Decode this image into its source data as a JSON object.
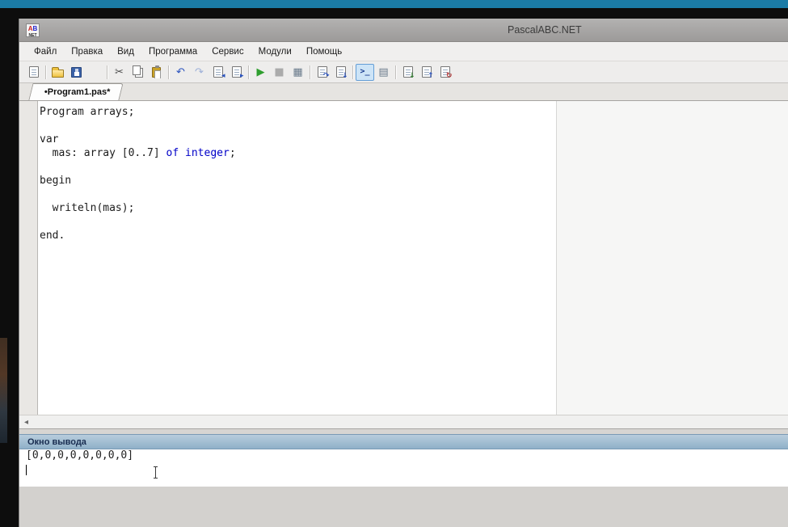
{
  "window": {
    "title": "PascalABC.NET",
    "logo_a": "A",
    "logo_b": "B",
    "logo_net": "NET"
  },
  "menu": {
    "items": [
      "Файл",
      "Правка",
      "Вид",
      "Программа",
      "Сервис",
      "Модули",
      "Помощь"
    ]
  },
  "toolbar": {
    "items": [
      {
        "name": "new-file",
        "kind": "page"
      },
      {
        "sep": true
      },
      {
        "name": "open-file",
        "kind": "folder"
      },
      {
        "name": "save-file",
        "kind": "floppy"
      },
      {
        "name": "save-all",
        "kind": "floppy2"
      },
      {
        "sep": true
      },
      {
        "name": "cut",
        "kind": "glyph",
        "glyph": "✂",
        "color": "#4a4a4a"
      },
      {
        "name": "copy",
        "kind": "copy"
      },
      {
        "name": "paste",
        "kind": "paste"
      },
      {
        "sep": true
      },
      {
        "name": "undo",
        "kind": "glyph",
        "glyph": "↶",
        "color": "#2a52be"
      },
      {
        "name": "redo",
        "kind": "glyph",
        "glyph": "↷",
        "color": "#9db0d8"
      },
      {
        "name": "prev-location",
        "kind": "page",
        "badge": "◂",
        "badgeColor": "#2a52be"
      },
      {
        "name": "next-location",
        "kind": "page",
        "badge": "▸",
        "badgeColor": "#2a52be"
      },
      {
        "sep": true
      },
      {
        "name": "run",
        "kind": "glyph",
        "glyph": "▶",
        "color": "#2f9e2f"
      },
      {
        "name": "stop",
        "kind": "glyph",
        "glyph": "■",
        "color": "#ababab"
      },
      {
        "name": "compile",
        "kind": "glyph",
        "glyph": "▦",
        "color": "#68798a"
      },
      {
        "sep": true
      },
      {
        "name": "step-over",
        "kind": "page",
        "badge": "↷",
        "badgeColor": "#2a52be"
      },
      {
        "name": "step-into",
        "kind": "page",
        "badge": "↓",
        "badgeColor": "#2a52be"
      },
      {
        "sep": true
      },
      {
        "name": "output-window-toggle",
        "kind": "glyph",
        "glyph": ">_",
        "color": "#1a3c8f",
        "pressed": true,
        "mono": true
      },
      {
        "name": "show-form",
        "kind": "glyph",
        "glyph": "▤",
        "color": "#68798a"
      },
      {
        "sep": true
      },
      {
        "name": "add-unit",
        "kind": "page",
        "badge": "↓",
        "badgeColor": "#2f7f2f"
      },
      {
        "name": "goto-unit",
        "kind": "page",
        "badge": "↑",
        "badgeColor": "#2a52be"
      },
      {
        "name": "reload-unit",
        "kind": "page",
        "badge": "↻",
        "badgeColor": "#b03030"
      }
    ]
  },
  "tab": {
    "label": "•Program1.pas*"
  },
  "editor": {
    "lines": [
      [
        {
          "t": "Program arrays;",
          "c": "plain"
        }
      ],
      [],
      [
        {
          "t": "var",
          "c": "plain"
        }
      ],
      [
        {
          "t": "  mas: array [0..7] ",
          "c": "plain"
        },
        {
          "t": "of",
          "c": "kw"
        },
        {
          "t": " ",
          "c": "plain"
        },
        {
          "t": "integer",
          "c": "kw"
        },
        {
          "t": ";",
          "c": "plain"
        }
      ],
      [],
      [
        {
          "t": "begin",
          "c": "plain"
        }
      ],
      [],
      [
        {
          "t": "  writeln(mas);",
          "c": "plain"
        }
      ],
      [],
      [
        {
          "t": "end.",
          "c": "plain"
        }
      ]
    ]
  },
  "scrollbar": {
    "left_arrow": "◂"
  },
  "output": {
    "header": "Окно вывода",
    "lines": [
      "[0,0,0,0,0,0,0,0]",
      ""
    ]
  },
  "colors": {
    "keyword": "#0000c8",
    "top_strip": "#1b7ba6",
    "output_header_top": "#b8cddd",
    "output_header_bottom": "#8fb0c8",
    "run_green": "#2f9e2f"
  }
}
